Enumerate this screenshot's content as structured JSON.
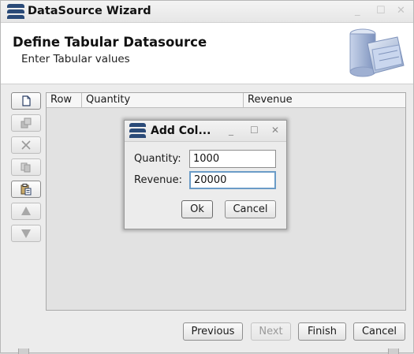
{
  "window": {
    "title": "DataSource Wizard",
    "controls": {
      "minimize": "_",
      "maximize": "☐",
      "close": "✕"
    }
  },
  "header": {
    "title": "Define Tabular Datasource",
    "subtitle": "Enter Tabular values"
  },
  "toolbar": {
    "items": [
      {
        "icon": "new-row-icon",
        "enabled": true
      },
      {
        "icon": "edit-icon",
        "enabled": false
      },
      {
        "icon": "delete-icon",
        "enabled": false
      },
      {
        "icon": "copy-icon",
        "enabled": false
      },
      {
        "icon": "paste-icon",
        "enabled": true
      },
      {
        "icon": "move-up-icon",
        "enabled": false
      },
      {
        "icon": "move-down-icon",
        "enabled": false
      }
    ]
  },
  "table": {
    "columns": [
      "Row",
      "Quantity",
      "Revenue"
    ]
  },
  "footer": {
    "previous": "Previous",
    "next": "Next",
    "finish": "Finish",
    "cancel": "Cancel"
  },
  "dialog": {
    "title": "Add Col...",
    "controls": {
      "minimize": "_",
      "maximize": "☐",
      "close": "✕"
    },
    "fields": [
      {
        "label": "Quantity:",
        "value": "1000"
      },
      {
        "label": "Revenue:",
        "value": "20000"
      }
    ],
    "ok": "Ok",
    "cancel": "Cancel"
  }
}
